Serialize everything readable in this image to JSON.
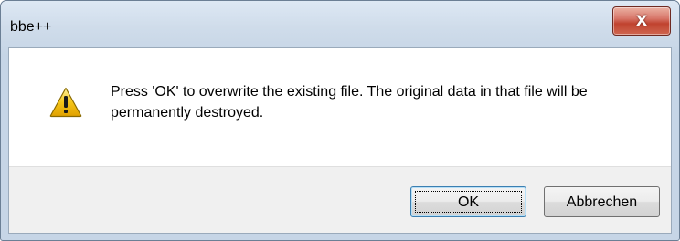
{
  "window": {
    "title": "bbe++",
    "close_label": "X"
  },
  "dialog": {
    "icon": "warning-icon",
    "message": "Press 'OK' to overwrite the existing file. The original data in that file will be permanently destroyed."
  },
  "buttons": {
    "ok_label": "OK",
    "cancel_label": "Abbrechen"
  },
  "colors": {
    "close_button": "#c0432f",
    "warning_fill": "#f5c518",
    "default_button_border": "#3c7fb1"
  }
}
